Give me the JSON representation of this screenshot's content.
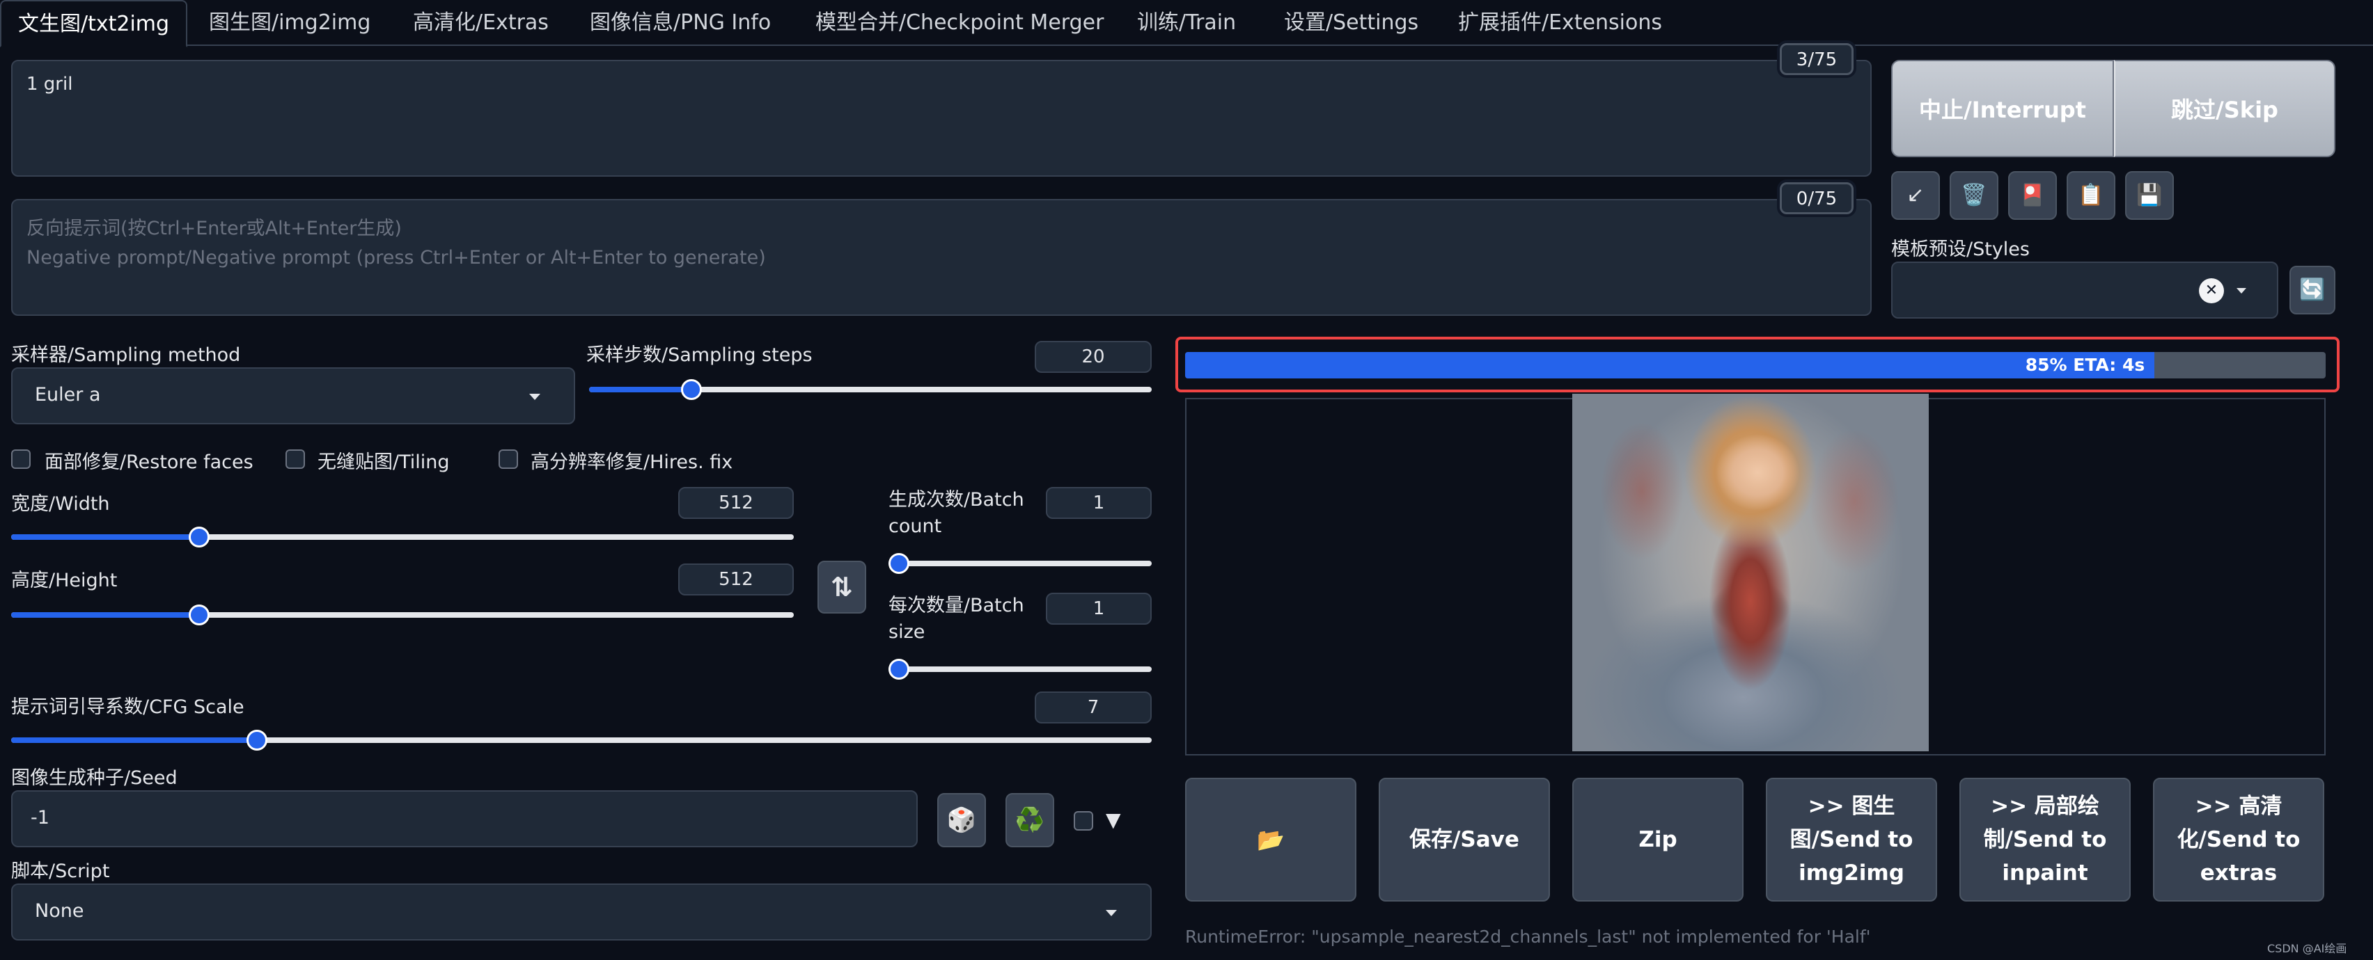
{
  "tabs": [
    {
      "label": "文生图/txt2img",
      "active": true
    },
    {
      "label": "图生图/img2img"
    },
    {
      "label": "高清化/Extras"
    },
    {
      "label": "图像信息/PNG Info"
    },
    {
      "label": "模型合并/Checkpoint Merger"
    },
    {
      "label": "训练/Train"
    },
    {
      "label": "设置/Settings"
    },
    {
      "label": "扩展插件/Extensions"
    }
  ],
  "prompt": {
    "value": "1 gril",
    "token_count": "3/75"
  },
  "negative_prompt": {
    "placeholder_line1": "反向提示词(按Ctrl+Enter或Alt+Enter生成)",
    "placeholder_line2": "Negative prompt/Negative prompt (press Ctrl+Enter or Alt+Enter to generate)",
    "token_count": "0/75"
  },
  "actions": {
    "interrupt_label": "中止/Interrupt",
    "skip_label": "跳过/Skip"
  },
  "tools": [
    {
      "icon": "arrow-down-left-icon",
      "glyph": "↙"
    },
    {
      "icon": "trash-icon",
      "glyph": "🗑️"
    },
    {
      "icon": "red-button-icon",
      "glyph": "🎴"
    },
    {
      "icon": "clipboard-icon",
      "glyph": "📋"
    },
    {
      "icon": "save-icon",
      "glyph": "💾"
    }
  ],
  "styles": {
    "label": "模板预设/Styles",
    "value": "",
    "clear_glyph": "✕",
    "refresh_glyph": "🔄"
  },
  "sampler": {
    "label": "采样器/Sampling method",
    "value": "Euler a"
  },
  "steps": {
    "label": "采样步数/Sampling steps",
    "value": "20",
    "fraction": 0.17
  },
  "checkboxes": {
    "restore_faces": "面部修复/Restore faces",
    "tiling": "无缝贴图/Tiling",
    "hires_fix": "高分辨率修复/Hires. fix"
  },
  "width": {
    "label": "宽度/Width",
    "value": "512",
    "fraction": 0.233
  },
  "height": {
    "label": "高度/Height",
    "value": "512",
    "fraction": 0.233
  },
  "swap_glyph": "⇅",
  "batch_count": {
    "label_line1": "生成次数/Batch",
    "label_line2": "count",
    "value": "1",
    "fraction": 0.0
  },
  "batch_size": {
    "label_line1": "每次数量/Batch",
    "label_line2": "size",
    "value": "1",
    "fraction": 0.0
  },
  "cfg": {
    "label": "提示词引导系数/CFG Scale",
    "value": "7",
    "fraction": 0.21
  },
  "seed": {
    "label": "图像生成种子/Seed",
    "value": "-1",
    "dice_glyph": "🎲",
    "recycle_glyph": "♻️",
    "extra_toggle_glyph": "▼"
  },
  "script": {
    "label": "脚本/Script",
    "value": "None"
  },
  "progress": {
    "text": "85% ETA: 4s",
    "fraction": 0.85
  },
  "gallery_buttons": [
    {
      "name": "open-folder-button",
      "label": "📂"
    },
    {
      "name": "save-button",
      "label": "保存/Save"
    },
    {
      "name": "zip-button",
      "label": "Zip"
    },
    {
      "name": "send-to-img2img-button",
      "label": ">> 图生图/Send to img2img"
    },
    {
      "name": "send-to-inpaint-button",
      "label": ">> 局部绘制/Send to inpaint"
    },
    {
      "name": "send-to-extras-button",
      "label": ">> 高清化/Send to extras"
    }
  ],
  "error_text": "RuntimeError: \"upsample_nearest2d_channels_last\" not implemented for 'Half'",
  "watermark": "CSDN @AI绘画",
  "colors": {
    "accent": "#2563eb",
    "background": "#0b0f19",
    "highlight_border": "#ef4444"
  }
}
